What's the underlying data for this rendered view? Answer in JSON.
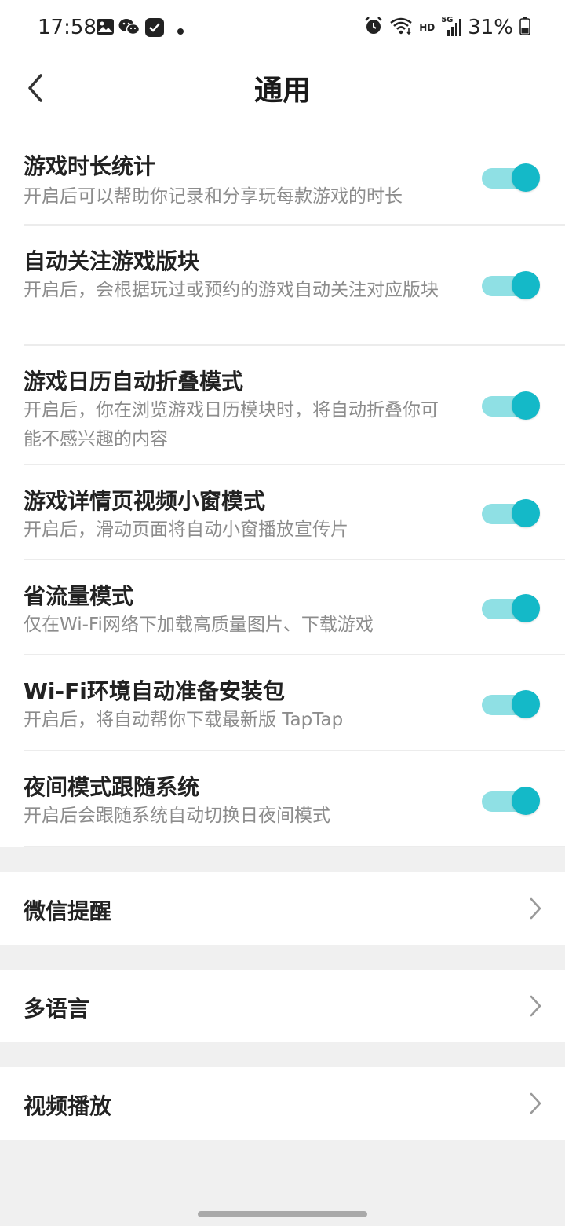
{
  "status_bar": {
    "time": "17:58",
    "battery_percent": "31%",
    "network_labels": [
      "HD",
      "5G"
    ],
    "left_icons": [
      "gallery-icon",
      "wechat-icon",
      "message-check-icon",
      "dot-icon"
    ],
    "right_icons": [
      "alarm-icon",
      "wifi-icon",
      "signal-icon",
      "battery-icon"
    ]
  },
  "header": {
    "title": "通用",
    "back_icon": "chevron-left-icon"
  },
  "toggles": [
    {
      "title": "游戏时长统计",
      "desc": "开启后可以帮助你记录和分享玩每款游戏的时长",
      "enabled": true
    },
    {
      "title": "自动关注游戏版块",
      "desc": "开启后，会根据玩过或预约的游戏自动关注对应版块",
      "enabled": true
    },
    {
      "title": "游戏日历自动折叠模式",
      "desc": "开启后，你在浏览游戏日历模块时，将自动折叠你可能不感兴趣的内容",
      "enabled": true
    },
    {
      "title": "游戏详情页视频小窗模式",
      "desc": "开启后，滑动页面将自动小窗播放宣传片",
      "enabled": true
    },
    {
      "title": "省流量模式",
      "desc": "仅在Wi-Fi网络下加载高质量图片、下载游戏",
      "enabled": true
    },
    {
      "title": "Wi-Fi环境自动准备安装包",
      "desc": "开启后，将自动帮你下载最新版 TapTap",
      "enabled": true
    },
    {
      "title": "夜间模式跟随系统",
      "desc": "开启后会跟随系统自动切换日夜间模式",
      "enabled": true
    }
  ],
  "nav_items": [
    {
      "label": "微信提醒"
    },
    {
      "label": "多语言"
    },
    {
      "label": "视频播放"
    }
  ],
  "colors": {
    "accent": "#14b9c8",
    "track": "#8fe0e4",
    "background": "#f0f0f0"
  }
}
